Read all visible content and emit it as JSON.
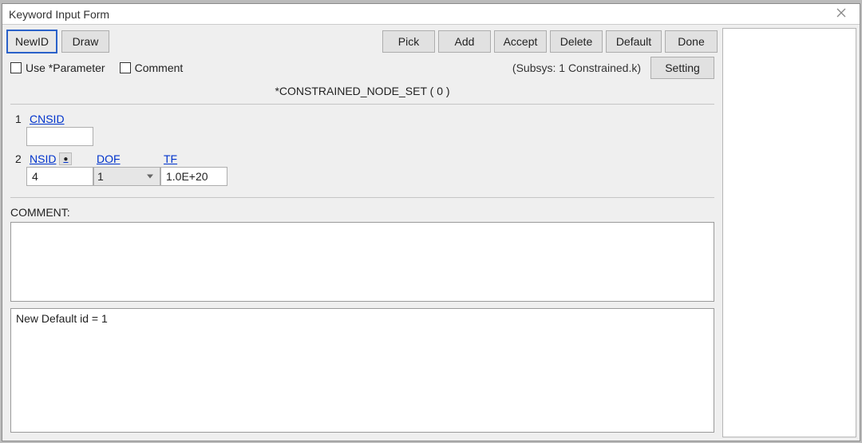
{
  "title": "Keyword Input Form",
  "toolbar": {
    "new_id": "NewID",
    "draw": "Draw",
    "pick": "Pick",
    "add": "Add",
    "accept": "Accept",
    "delete": "Delete",
    "default": "Default",
    "done": "Done"
  },
  "options": {
    "use_parameter_label": "Use *Parameter",
    "comment_label": "Comment",
    "subsys_label": "(Subsys: 1 Constrained.k)",
    "setting_label": "Setting"
  },
  "keyword_line": "*CONSTRAINED_NODE_SET    ( 0 )",
  "cards": {
    "row1_index": "1",
    "row2_index": "2",
    "cnsid_label": "CNSID",
    "cnsid_value": "",
    "nsid_label": "NSID",
    "nsid_value": "4",
    "dof_label": "DOF",
    "dof_value": "1",
    "tf_label": "TF",
    "tf_value": "1.0E+20"
  },
  "comment_section_label": "COMMENT:",
  "comment_value": "",
  "status_text": "New Default id = 1"
}
